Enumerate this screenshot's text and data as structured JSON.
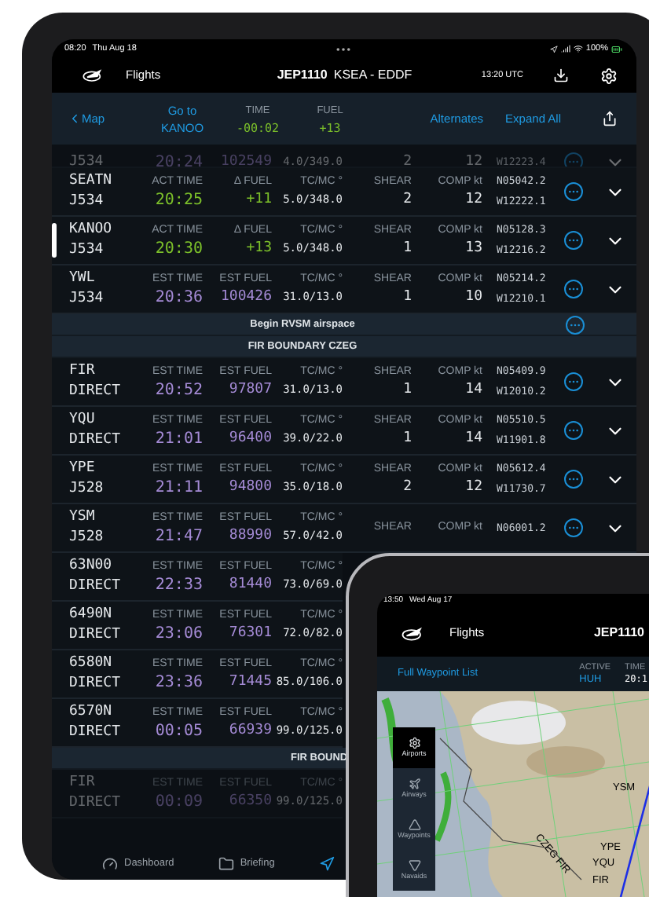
{
  "main_screen": {
    "status_bar": {
      "time": "08:20",
      "date": "Thu Aug 18",
      "battery": "100%"
    },
    "header": {
      "title": "Flights",
      "flight": "JEP1110",
      "route": "KSEA - EDDF",
      "utc": "13:20 UTC"
    },
    "subheader": {
      "back": "Map",
      "goto": "Go to",
      "goto_target": "KANOO",
      "time_label": "TIME",
      "time_value": "-00:02",
      "fuel_label": "FUEL",
      "fuel_value": "+13",
      "alternates": "Alternates",
      "expand": "Expand All"
    },
    "waypoints": [
      {
        "kind": "partial",
        "airway": "J534",
        "time": "20:24",
        "fuel": "102549",
        "track": "4.0/349.0",
        "shear": "2",
        "comp": "12",
        "lon": "W12223.4",
        "faded": true,
        "current": false
      },
      {
        "kind": "waypoint",
        "name": "SEATN",
        "airway": "J534",
        "color": "#7cc02a",
        "time_label": "ACT TIME",
        "time": "20:25",
        "fuel_label": "Δ FUEL",
        "fuel": "+11",
        "track_label": "TC/MC °",
        "track": "5.0/348.0",
        "shear_label": "SHEAR",
        "shear": "2",
        "comp_label": "COMP kt",
        "comp": "12",
        "lat": "N05042.2",
        "lon": "W12222.1",
        "faded": false,
        "current": false
      },
      {
        "kind": "waypoint",
        "name": "KANOO",
        "airway": "J534",
        "color": "#7cc02a",
        "time_label": "ACT TIME",
        "time": "20:30",
        "fuel_label": "Δ FUEL",
        "fuel": "+13",
        "track_label": "TC/MC °",
        "track": "5.0/348.0",
        "shear_label": "SHEAR",
        "shear": "1",
        "comp_label": "COMP kt",
        "comp": "13",
        "lat": "N05128.3",
        "lon": "W12216.2",
        "faded": false,
        "current": true
      },
      {
        "kind": "waypoint",
        "name": "YWL",
        "airway": "J534",
        "color": "#a58bd6",
        "time_label": "EST TIME",
        "time": "20:36",
        "fuel_label": "EST FUEL",
        "fuel": "100426",
        "track_label": "TC/MC °",
        "track": "31.0/13.0",
        "shear_label": "SHEAR",
        "shear": "1",
        "comp_label": "COMP kt",
        "comp": "10",
        "lat": "N05214.2",
        "lon": "W12210.1",
        "faded": false,
        "current": false
      },
      {
        "kind": "remark",
        "text": "Begin RVSM airspace",
        "menu": true,
        "cut": false
      },
      {
        "kind": "remark",
        "text": "FIR BOUNDARY CZEG",
        "menu": false,
        "cut": false
      },
      {
        "kind": "waypoint",
        "name": "FIR",
        "airway": "DIRECT",
        "color": "#a58bd6",
        "time_label": "EST TIME",
        "time": "20:52",
        "fuel_label": "EST FUEL",
        "fuel": "97807",
        "track_label": "TC/MC °",
        "track": "31.0/13.0",
        "shear_label": "SHEAR",
        "shear": "1",
        "comp_label": "COMP kt",
        "comp": "14",
        "lat": "N05409.9",
        "lon": "W12010.2",
        "faded": false,
        "current": false
      },
      {
        "kind": "waypoint",
        "name": "YQU",
        "airway": "DIRECT",
        "color": "#a58bd6",
        "time_label": "EST TIME",
        "time": "21:01",
        "fuel_label": "EST FUEL",
        "fuel": "96400",
        "track_label": "TC/MC °",
        "track": "39.0/22.0",
        "shear_label": "SHEAR",
        "shear": "1",
        "comp_label": "COMP kt",
        "comp": "14",
        "lat": "N05510.5",
        "lon": "W11901.8",
        "faded": false,
        "current": false
      },
      {
        "kind": "waypoint",
        "name": "YPE",
        "airway": "J528",
        "color": "#a58bd6",
        "time_label": "EST TIME",
        "time": "21:11",
        "fuel_label": "EST FUEL",
        "fuel": "94800",
        "track_label": "TC/MC °",
        "track": "35.0/18.0",
        "shear_label": "SHEAR",
        "shear": "2",
        "comp_label": "COMP kt",
        "comp": "12",
        "lat": "N05612.4",
        "lon": "W11730.7",
        "faded": false,
        "current": false
      },
      {
        "kind": "waypoint",
        "name": "YSM",
        "airway": "J528",
        "color": "#a58bd6",
        "time_label": "EST TIME",
        "time": "21:47",
        "fuel_label": "EST FUEL",
        "fuel": "88990",
        "track_label": "TC/MC °",
        "track": "57.0/42.0",
        "shear_label": "SHEAR",
        "comp_label": "COMP kt",
        "lat": "N06001.2",
        "faded": false,
        "current": false
      },
      {
        "kind": "waypoint",
        "name": "63N00",
        "airway": "DIRECT",
        "color": "#a58bd6",
        "time_label": "EST TIME",
        "time": "22:33",
        "fuel_label": "EST FUEL",
        "fuel": "81440",
        "track_label": "TC/MC °",
        "track": "73.0/69.0",
        "faded": false,
        "current": false
      },
      {
        "kind": "waypoint",
        "name": "6490N",
        "airway": "DIRECT",
        "color": "#a58bd6",
        "time_label": "EST TIME",
        "time": "23:06",
        "fuel_label": "EST FUEL",
        "fuel": "76301",
        "track_label": "TC/MC °",
        "track": "72.0/82.0",
        "faded": false,
        "current": false
      },
      {
        "kind": "waypoint",
        "name": "6580N",
        "airway": "DIRECT",
        "color": "#a58bd6",
        "time_label": "EST TIME",
        "time": "23:36",
        "fuel_label": "EST FUEL",
        "fuel": "71445",
        "track_label": "TC/MC °",
        "track": "85.0/106.0",
        "faded": false,
        "current": false
      },
      {
        "kind": "waypoint",
        "name": "6570N",
        "airway": "DIRECT",
        "color": "#a58bd6",
        "time_label": "EST TIME",
        "time": "00:05",
        "fuel_label": "EST FUEL",
        "fuel": "66939",
        "track_label": "TC/MC °",
        "track": "99.0/125.0",
        "faded": false,
        "current": false
      },
      {
        "kind": "remark",
        "text": "FIR BOUND",
        "menu": false,
        "cut": true
      },
      {
        "kind": "waypoint",
        "name": "FIR",
        "airway": "DIRECT",
        "time_label": "EST TIME",
        "time": "00:09",
        "fuel_label": "EST FUEL",
        "fuel": "66350",
        "track_label": "TC/MC °",
        "track": "99.0/125.0",
        "faded": true,
        "current": false
      }
    ],
    "tab_bar": [
      {
        "label": "Dashboard",
        "selected": false
      },
      {
        "label": "Briefing",
        "selected": false
      },
      {
        "selected": true
      }
    ]
  },
  "inset_screen": {
    "status_bar": {
      "time": "13:50",
      "date": "Wed Aug 17"
    },
    "header": {
      "title": "Flights",
      "flight": "JEP1110"
    },
    "subheader": {
      "link": "Full Waypoint List",
      "active_label": "ACTIVE",
      "active_value": "HUH",
      "time_label": "TIME",
      "time_value": "20:1"
    },
    "map_tools": [
      {
        "label": "Airports",
        "selected": true
      },
      {
        "label": "Airways",
        "selected": false
      },
      {
        "label": "Waypoints",
        "selected": false
      },
      {
        "label": "Navaids",
        "selected": false
      }
    ],
    "map_labels": [
      {
        "text": "YSM"
      },
      {
        "text": "YPE"
      },
      {
        "text": "YQU"
      },
      {
        "text": "FIR"
      },
      {
        "text": "CZEG FIR"
      }
    ]
  }
}
